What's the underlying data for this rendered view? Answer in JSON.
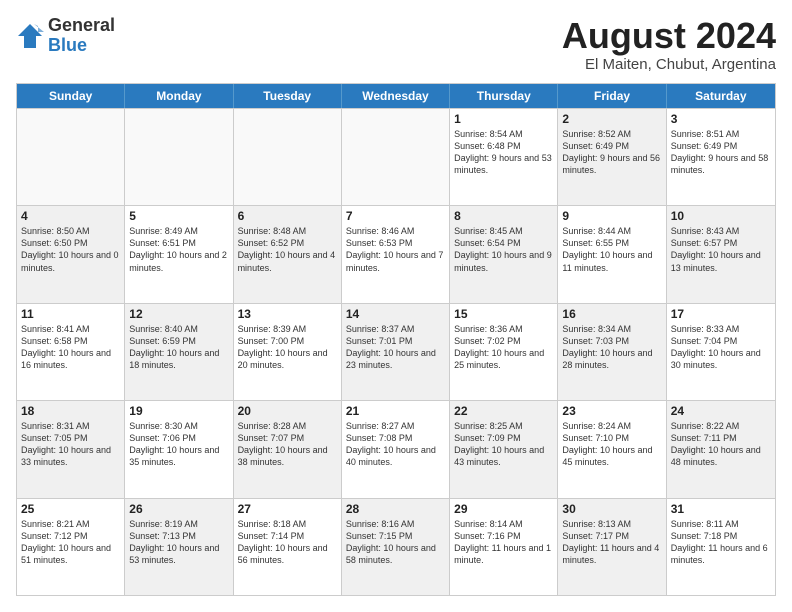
{
  "logo": {
    "general": "General",
    "blue": "Blue"
  },
  "title": {
    "month": "August 2024",
    "location": "El Maiten, Chubut, Argentina"
  },
  "weekdays": [
    "Sunday",
    "Monday",
    "Tuesday",
    "Wednesday",
    "Thursday",
    "Friday",
    "Saturday"
  ],
  "rows": [
    [
      {
        "day": "",
        "info": "",
        "empty": true
      },
      {
        "day": "",
        "info": "",
        "empty": true
      },
      {
        "day": "",
        "info": "",
        "empty": true
      },
      {
        "day": "",
        "info": "",
        "empty": true
      },
      {
        "day": "1",
        "info": "Sunrise: 8:54 AM\nSunset: 6:48 PM\nDaylight: 9 hours\nand 53 minutes."
      },
      {
        "day": "2",
        "info": "Sunrise: 8:52 AM\nSunset: 6:49 PM\nDaylight: 9 hours\nand 56 minutes.",
        "shaded": true
      },
      {
        "day": "3",
        "info": "Sunrise: 8:51 AM\nSunset: 6:49 PM\nDaylight: 9 hours\nand 58 minutes."
      }
    ],
    [
      {
        "day": "4",
        "info": "Sunrise: 8:50 AM\nSunset: 6:50 PM\nDaylight: 10 hours\nand 0 minutes.",
        "shaded": true
      },
      {
        "day": "5",
        "info": "Sunrise: 8:49 AM\nSunset: 6:51 PM\nDaylight: 10 hours\nand 2 minutes."
      },
      {
        "day": "6",
        "info": "Sunrise: 8:48 AM\nSunset: 6:52 PM\nDaylight: 10 hours\nand 4 minutes.",
        "shaded": true
      },
      {
        "day": "7",
        "info": "Sunrise: 8:46 AM\nSunset: 6:53 PM\nDaylight: 10 hours\nand 7 minutes."
      },
      {
        "day": "8",
        "info": "Sunrise: 8:45 AM\nSunset: 6:54 PM\nDaylight: 10 hours\nand 9 minutes.",
        "shaded": true
      },
      {
        "day": "9",
        "info": "Sunrise: 8:44 AM\nSunset: 6:55 PM\nDaylight: 10 hours\nand 11 minutes."
      },
      {
        "day": "10",
        "info": "Sunrise: 8:43 AM\nSunset: 6:57 PM\nDaylight: 10 hours\nand 13 minutes.",
        "shaded": true
      }
    ],
    [
      {
        "day": "11",
        "info": "Sunrise: 8:41 AM\nSunset: 6:58 PM\nDaylight: 10 hours\nand 16 minutes."
      },
      {
        "day": "12",
        "info": "Sunrise: 8:40 AM\nSunset: 6:59 PM\nDaylight: 10 hours\nand 18 minutes.",
        "shaded": true
      },
      {
        "day": "13",
        "info": "Sunrise: 8:39 AM\nSunset: 7:00 PM\nDaylight: 10 hours\nand 20 minutes."
      },
      {
        "day": "14",
        "info": "Sunrise: 8:37 AM\nSunset: 7:01 PM\nDaylight: 10 hours\nand 23 minutes.",
        "shaded": true
      },
      {
        "day": "15",
        "info": "Sunrise: 8:36 AM\nSunset: 7:02 PM\nDaylight: 10 hours\nand 25 minutes."
      },
      {
        "day": "16",
        "info": "Sunrise: 8:34 AM\nSunset: 7:03 PM\nDaylight: 10 hours\nand 28 minutes.",
        "shaded": true
      },
      {
        "day": "17",
        "info": "Sunrise: 8:33 AM\nSunset: 7:04 PM\nDaylight: 10 hours\nand 30 minutes."
      }
    ],
    [
      {
        "day": "18",
        "info": "Sunrise: 8:31 AM\nSunset: 7:05 PM\nDaylight: 10 hours\nand 33 minutes.",
        "shaded": true
      },
      {
        "day": "19",
        "info": "Sunrise: 8:30 AM\nSunset: 7:06 PM\nDaylight: 10 hours\nand 35 minutes."
      },
      {
        "day": "20",
        "info": "Sunrise: 8:28 AM\nSunset: 7:07 PM\nDaylight: 10 hours\nand 38 minutes.",
        "shaded": true
      },
      {
        "day": "21",
        "info": "Sunrise: 8:27 AM\nSunset: 7:08 PM\nDaylight: 10 hours\nand 40 minutes."
      },
      {
        "day": "22",
        "info": "Sunrise: 8:25 AM\nSunset: 7:09 PM\nDaylight: 10 hours\nand 43 minutes.",
        "shaded": true
      },
      {
        "day": "23",
        "info": "Sunrise: 8:24 AM\nSunset: 7:10 PM\nDaylight: 10 hours\nand 45 minutes."
      },
      {
        "day": "24",
        "info": "Sunrise: 8:22 AM\nSunset: 7:11 PM\nDaylight: 10 hours\nand 48 minutes.",
        "shaded": true
      }
    ],
    [
      {
        "day": "25",
        "info": "Sunrise: 8:21 AM\nSunset: 7:12 PM\nDaylight: 10 hours\nand 51 minutes."
      },
      {
        "day": "26",
        "info": "Sunrise: 8:19 AM\nSunset: 7:13 PM\nDaylight: 10 hours\nand 53 minutes.",
        "shaded": true
      },
      {
        "day": "27",
        "info": "Sunrise: 8:18 AM\nSunset: 7:14 PM\nDaylight: 10 hours\nand 56 minutes."
      },
      {
        "day": "28",
        "info": "Sunrise: 8:16 AM\nSunset: 7:15 PM\nDaylight: 10 hours\nand 58 minutes.",
        "shaded": true
      },
      {
        "day": "29",
        "info": "Sunrise: 8:14 AM\nSunset: 7:16 PM\nDaylight: 11 hours\nand 1 minute."
      },
      {
        "day": "30",
        "info": "Sunrise: 8:13 AM\nSunset: 7:17 PM\nDaylight: 11 hours\nand 4 minutes.",
        "shaded": true
      },
      {
        "day": "31",
        "info": "Sunrise: 8:11 AM\nSunset: 7:18 PM\nDaylight: 11 hours\nand 6 minutes."
      }
    ]
  ]
}
